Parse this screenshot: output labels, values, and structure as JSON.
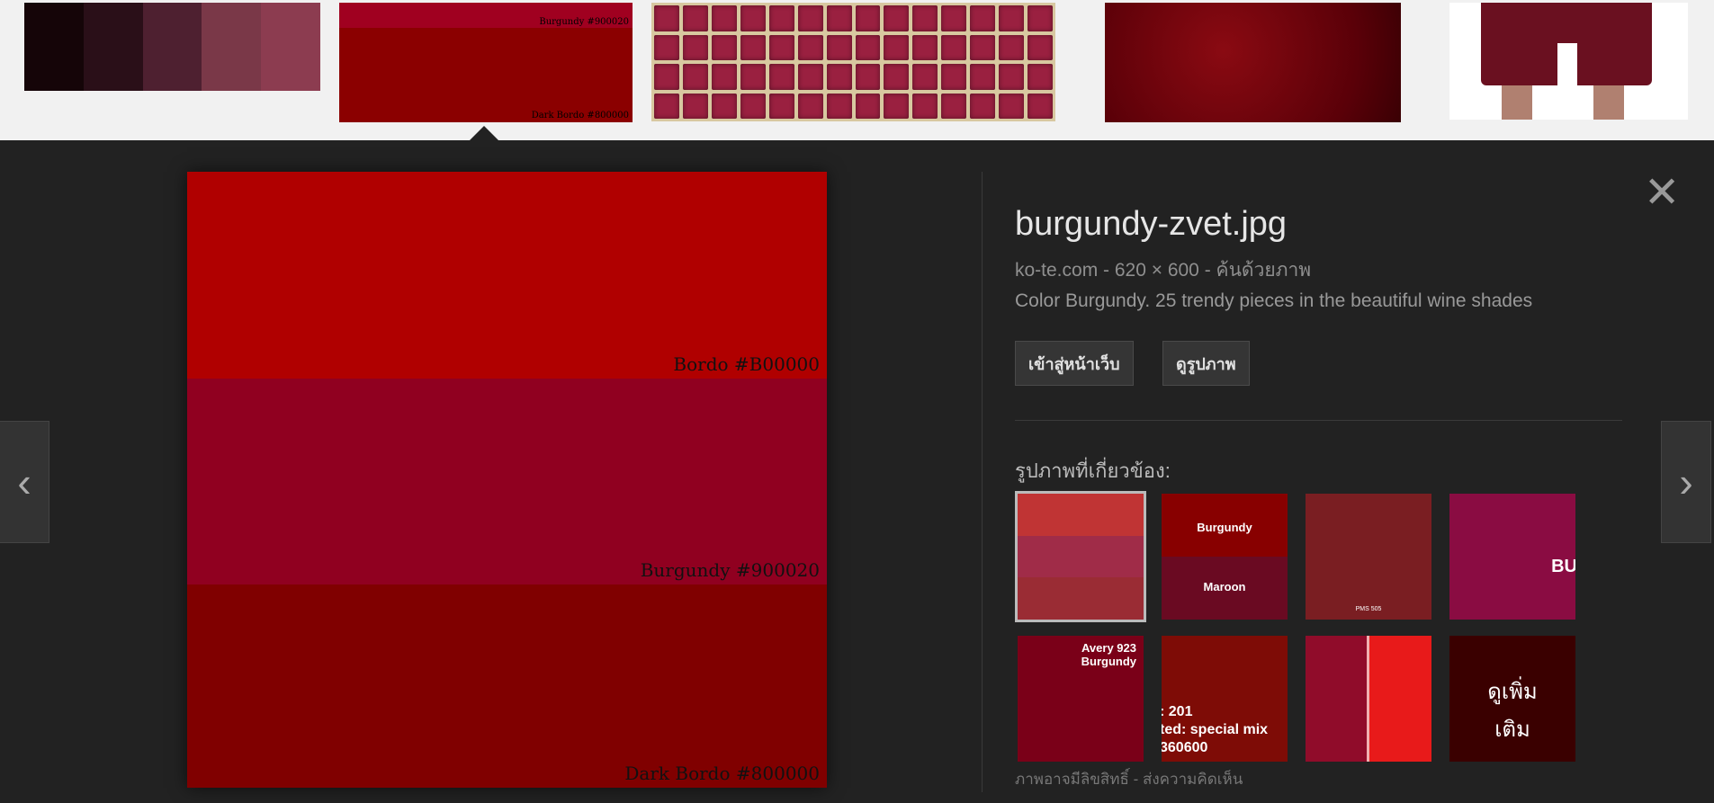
{
  "strip": {
    "thumb1_swatches": [
      "#150508",
      "#2a0f18",
      "#4e2030",
      "#7a3848",
      "#8c3c50"
    ],
    "thumb2": {
      "top_label": "Burgundy #900020",
      "bottom_label": "Dark Bordo #800000"
    }
  },
  "preview": {
    "bands": [
      {
        "color": "#b00000",
        "label": "Bordo #B00000"
      },
      {
        "color": "#900020",
        "label": "Burgundy #900020"
      },
      {
        "color": "#800000",
        "label": "Dark Bordo #800000"
      }
    ],
    "nav_prev_icon": "‹",
    "nav_next_icon": "›",
    "close_icon": "✕"
  },
  "info": {
    "title": "burgundy-zvet.jpg",
    "meta": "ko-te.com  - 620 × 600 - ค้นด้วยภาพ",
    "description": "Color Burgundy. 25 trendy pieces in the beautiful wine shades",
    "visit_button": "เข้าสู่หน้าเว็บ",
    "view_button": "ดูรูปภาพ",
    "related_title": "รูปภาพที่เกี่ยวข้อง:",
    "related": [
      {
        "labels": []
      },
      {
        "labels": [
          "Burgundy",
          "Maroon"
        ]
      },
      {
        "labels": [
          "PMS 505"
        ]
      },
      {
        "labels": [
          "BU"
        ]
      },
      {
        "labels": [
          "Avery 923",
          "Burgundy"
        ]
      },
      {
        "labels": [
          ": 201",
          "ted: special mix",
          "360600"
        ]
      },
      {
        "labels": []
      },
      {
        "labels": [
          "ดูเพิ่ม",
          "เติม"
        ]
      }
    ],
    "footer": "ภาพอาจมีลิขสิทธิ์  - ส่งความคิดเห็น"
  }
}
